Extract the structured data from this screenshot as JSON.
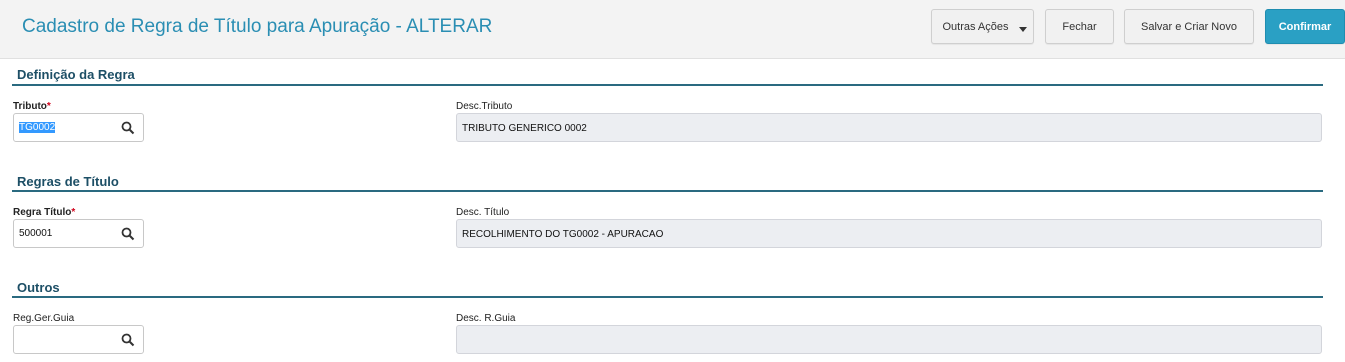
{
  "header": {
    "title": "Cadastro de Regra de Título para Apuração - ALTERAR",
    "buttons": {
      "outras_acoes": "Outras Ações",
      "fechar": "Fechar",
      "salvar_criar_novo": "Salvar e Criar Novo",
      "confirmar": "Confirmar"
    }
  },
  "sections": [
    {
      "title": "Definição da Regra",
      "fields": {
        "code_label": "Tributo",
        "code_value": "TG0002",
        "code_required": "*",
        "desc_label": "Desc.Tributo",
        "desc_value": "TRIBUTO GENERICO 0002"
      }
    },
    {
      "title": "Regras de Título",
      "fields": {
        "code_label": "Regra Título",
        "code_value": "500001",
        "code_required": "*",
        "desc_label": "Desc. Título",
        "desc_value": "RECOLHIMENTO DO TG0002 - APURACAO"
      }
    },
    {
      "title": "Outros",
      "fields": {
        "code_label": "Reg.Ger.Guia",
        "code_value": "",
        "desc_label": "Desc. R.Guia",
        "desc_value": ""
      }
    }
  ],
  "colors": {
    "title": "#2a8eb3",
    "primary_button": "#2aa0c4",
    "section_line": "#2a6a80",
    "required_mark": "#d0021b"
  },
  "icons": [
    "search-icon",
    "chevron-down-icon"
  ]
}
